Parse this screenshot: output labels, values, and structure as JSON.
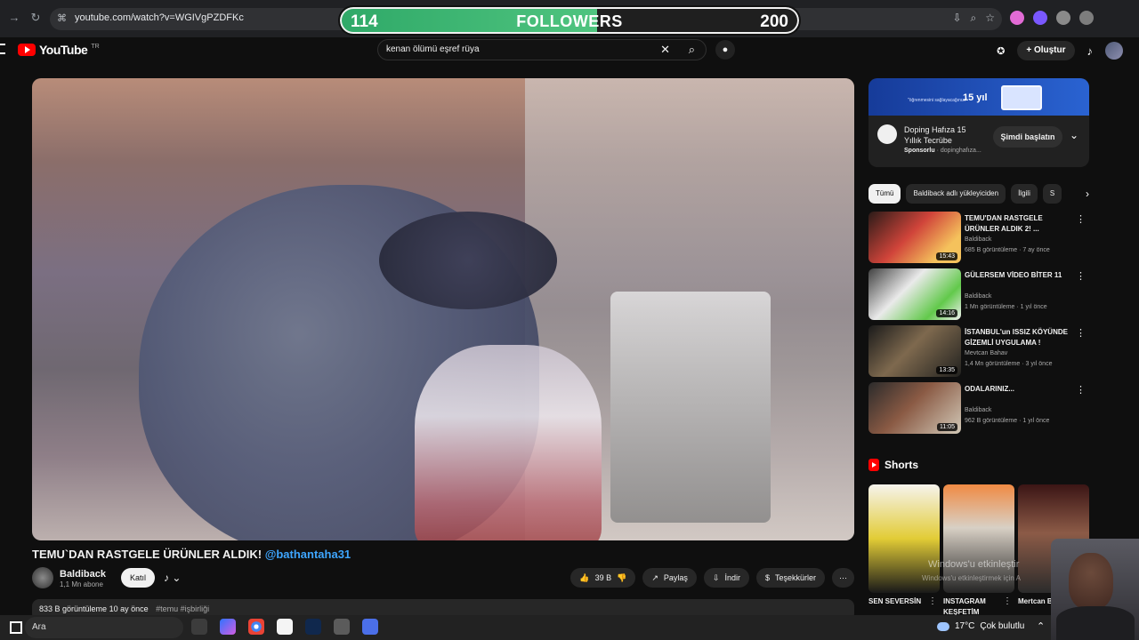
{
  "browser": {
    "url": "youtube.com/watch?v=WGIVgPZDFKc"
  },
  "overlay": {
    "current": "114",
    "label": "FOLLOWERS",
    "goal": "200",
    "progress_fraction": 0.57
  },
  "header": {
    "logo": "YouTube",
    "region": "TR",
    "search_query": "kenan ölümü eşref rüya",
    "create_label": "Oluştur"
  },
  "video": {
    "title": "TEMU`DAN RASTGELE ÜRÜNLER ALDIK!",
    "mention": "@bathantaha31",
    "channel": "Baldiback",
    "subscribers": "1,1 Mn abone",
    "join_label": "Katıl",
    "likes": "39 B",
    "share_label": "Paylaş",
    "download_label": "İndir",
    "thanks_label": "Teşekkürler",
    "description": {
      "views": "833 B görüntüleme",
      "age": "10 ay önce",
      "hashtag": "#temu #işbirliği"
    }
  },
  "ad": {
    "banner_small": "\"öğrenmesini sağlayacağınızı\"",
    "banner_years": "15 yıl",
    "title": "Doping Hafıza 15 Yıllık Tecrübe",
    "sponsor_label": "Sponsorlu",
    "domain": "dopinghafıza...",
    "cta": "Şimdi başlatın"
  },
  "chips": [
    {
      "label": "Tümü",
      "active": true
    },
    {
      "label": "Baldiback adlı yükleyiciden",
      "active": false
    },
    {
      "label": "İlgili",
      "active": false
    },
    {
      "label": "S",
      "active": false
    }
  ],
  "recommendations": [
    {
      "title": "TEMU'DAN RASTGELE ÜRÜNLER ALDIK 2! ...",
      "channel": "Baldiback",
      "views": "685 B görüntüleme",
      "age": "7 ay önce",
      "duration": "15:43"
    },
    {
      "title": "GÜLERSEM VİDEO BİTER 11",
      "channel": "Baldiback",
      "views": "1 Mn görüntüleme",
      "age": "1 yıl önce",
      "duration": "14:16"
    },
    {
      "title": "İSTANBUL'un ISSIZ KÖYÜNDE GİZEMLİ UYGULAMA !",
      "channel": "Mevtcan Bahav",
      "views": "1,4 Mn görüntüleme",
      "age": "3 yıl önce",
      "duration": "13:35"
    },
    {
      "title": "ODALARINIZ...",
      "channel": "Baldiback",
      "views": "962 B görüntüleme",
      "age": "1 yıl önce",
      "duration": "11:05"
    }
  ],
  "shorts": {
    "title": "Shorts",
    "items": [
      {
        "label": "SEN SEVERSİN"
      },
      {
        "label": "INSTAGRAM KEŞFETİM"
      },
      {
        "label": "Mertcan Bahar"
      }
    ]
  },
  "watermark": {
    "line1": "Windows'u etkinleştir",
    "line2": "Windows'u etkinleştirmek için A"
  },
  "taskbar": {
    "search_label": "Ara",
    "temperature": "17°C",
    "weather": "Çok bulutlu"
  }
}
